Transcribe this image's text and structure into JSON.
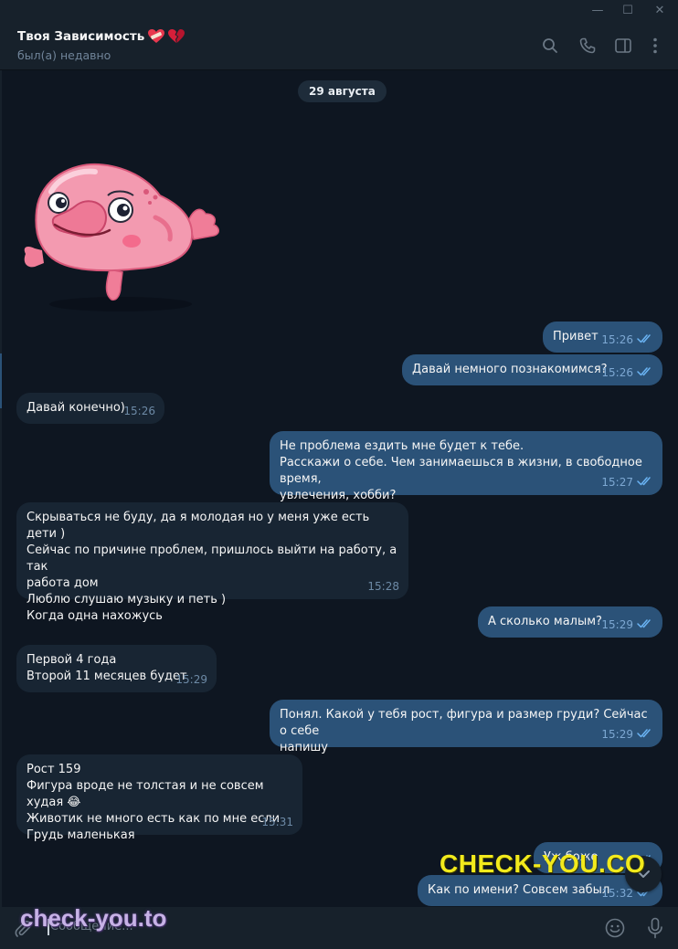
{
  "window": {
    "minimize_glyph": "—",
    "maximize_glyph": "☐",
    "close_glyph": "✕"
  },
  "header": {
    "title": "Твоя Зависимость",
    "title_emojis": [
      "heart-with-bandage-icon",
      "broken-heart-icon"
    ],
    "status": "был(а) недавно",
    "icons": [
      "search-icon",
      "phone-icon",
      "sidebar-toggle-icon",
      "more-vertical-icon"
    ]
  },
  "chat": {
    "date": "29 августа",
    "sticker": "pink-blobfish-sticker",
    "messages": [
      {
        "dir": "out",
        "text": "Привет",
        "time": "15:26",
        "read": true
      },
      {
        "dir": "out",
        "text": "Давай немного познакомимся?",
        "time": "15:26",
        "read": true
      },
      {
        "dir": "in",
        "text": "Давай конечно)",
        "time": "15:26"
      },
      {
        "dir": "out",
        "text": "Не проблема ездить мне будет к тебе.\nРасскажи о себе. Чем занимаешься в жизни, в свободное время,\nувлечения, хобби?",
        "time": "15:27",
        "read": true
      },
      {
        "dir": "in",
        "text": "Скрываться не буду, да я молодая но у меня уже есть дети )\nСейчас по причине проблем, пришлось выйти на работу, а так\nработа дом\nЛюблю слушаю музыку и петь )\nКогда одна нахожусь",
        "time": "15:28"
      },
      {
        "dir": "out",
        "text": "А сколько малым?",
        "time": "15:29",
        "read": true
      },
      {
        "dir": "in",
        "text": "Первой 4 года\nВторой 11 месяцев будет",
        "time": "15:29"
      },
      {
        "dir": "out",
        "text": "Понял. Какой у тебя рост, фигура и размер груди? Сейчас о себе\nнапишу",
        "time": "15:29",
        "read": true
      },
      {
        "dir": "in",
        "text": "Рост 159\nФигура вроде не толстая и не совсем худая 😂\nЖивотик не много есть как по мне если\nГрудь маленькая",
        "time": "15:31"
      },
      {
        "dir": "out",
        "text": "Уж боже",
        "time": "",
        "read": true
      },
      {
        "dir": "out",
        "text": "Как по имени? Совсем забыл",
        "time": "15:32",
        "read": true
      }
    ]
  },
  "composer": {
    "placeholder": "Сообщение...",
    "icons": [
      "attach-icon",
      "emoji-icon",
      "microphone-icon"
    ]
  },
  "watermarks": {
    "big": "CHECK-YOU.CO",
    "small": "check-you.to"
  },
  "colors": {
    "background": "#0e1621",
    "panel": "#17212b",
    "bubble_in": "#182533",
    "bubble_out": "#2b5278",
    "accent_check": "#6ab3f3",
    "watermark_yellow": "#f2ea1c"
  }
}
